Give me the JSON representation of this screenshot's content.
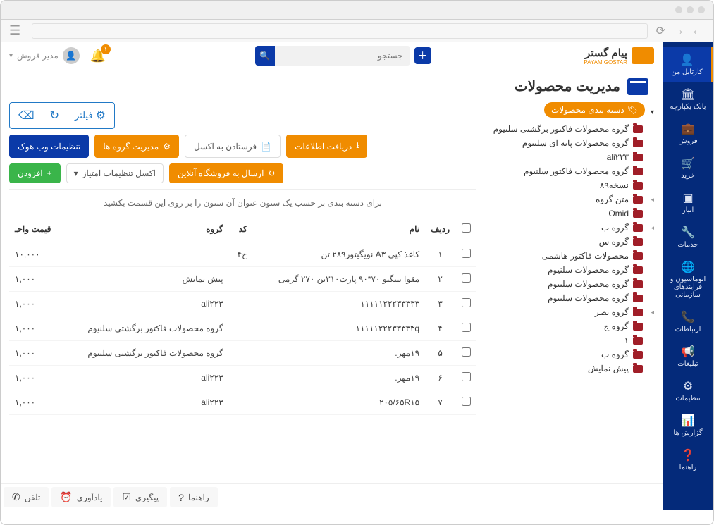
{
  "user": {
    "name": "مدیر فروش"
  },
  "notifications": {
    "count": "۱"
  },
  "search": {
    "placeholder": "جستجو"
  },
  "logo": {
    "text": "پیام گستر",
    "sub": "PAYAM GOSTAR"
  },
  "sidebar": {
    "items": [
      {
        "label": "کارتابل من"
      },
      {
        "label": "بانک یکپارچه"
      },
      {
        "label": "فروش"
      },
      {
        "label": "خرید"
      },
      {
        "label": "انبار"
      },
      {
        "label": "خدمات"
      },
      {
        "label": "اتوماسیون و فرآیندهای سازمانی"
      },
      {
        "label": "ارتباطات"
      },
      {
        "label": "تبلیغات"
      },
      {
        "label": "تنظیمات"
      },
      {
        "label": "گزارش ها"
      },
      {
        "label": "راهنما"
      }
    ]
  },
  "page": {
    "title": "مدیریت محصولات"
  },
  "tree": {
    "root": "دسته بندی محصولات",
    "items": [
      {
        "label": "گروه محصولات فاکتور برگشتی سلنیوم"
      },
      {
        "label": "گروه محصولات پایه ای سلنیوم"
      },
      {
        "label": "ali۲۲۳"
      },
      {
        "label": "گروه محصولات فاکتور سلنیوم"
      },
      {
        "label": "نسخه۸۹"
      },
      {
        "label": "متن گروه"
      },
      {
        "label": "Omid"
      },
      {
        "label": "گروه ب"
      },
      {
        "label": "گروه س"
      },
      {
        "label": "محصولات فاکتور هاشمی"
      },
      {
        "label": "گروه محصولات سلنیوم"
      },
      {
        "label": "گروه محصولات سلنیوم"
      },
      {
        "label": "گروه محصولات سلنیوم"
      },
      {
        "label": "گروه نصر"
      },
      {
        "label": "گروه ج"
      },
      {
        "label": "۱"
      },
      {
        "label": "گروه ب"
      },
      {
        "label": "پیش نمایش"
      }
    ]
  },
  "toolbar": {
    "filter": "فیلتر",
    "receive_info": "دریافت اطلاعات",
    "send_excel": "فرستادن به اکسل",
    "manage_groups": "مدیریت گروه ها",
    "webhook_settings": "تنظیمات وب هوک",
    "send_online_shop": "ارسال به فروشگاه آنلاین",
    "excel_settings": "اکسل تنظیمات امتیاز",
    "add": "افزودن"
  },
  "grid": {
    "hint": "برای دسته بندی بر حسب یک ستون عنوان آن ستون را بر روی این قسمت بکشید",
    "columns": [
      "ردیف",
      "نام",
      "کد",
      "گروه",
      "قیمت واحـ"
    ],
    "rows": [
      {
        "n": "۱",
        "name": "کاغذ کپی A۳ نویگیتور۲۸۹ تن",
        "code": "ج۴",
        "group": "",
        "price": "۱۰,۰۰۰"
      },
      {
        "n": "۲",
        "name": "مقوا نینگبو ۷۰*۹۰ پارت۳۱۰تن ۲۷۰ گرمی",
        "code": "",
        "group": "پیش نمایش",
        "price": "۱,۰۰۰"
      },
      {
        "n": "۳",
        "name": "۱۱۱۱۱۲۲۲۳۳۳۳۳",
        "code": "",
        "group": "ali۲۲۳",
        "price": "۱,۰۰۰"
      },
      {
        "n": "۴",
        "name": "۱۱۱۱۱۲۲۲۳۳۳۳۳q",
        "code": "",
        "group": "گروه محصولات فاکتور برگشتی سلنیوم",
        "price": "۱,۰۰۰"
      },
      {
        "n": "۵",
        "name": "۱۹مهر.",
        "code": "",
        "group": "گروه محصولات فاکتور برگشتی سلنیوم",
        "price": "۱,۰۰۰"
      },
      {
        "n": "۶",
        "name": "۱۹مهر.",
        "code": "",
        "group": "ali۲۲۳",
        "price": "۱,۰۰۰"
      },
      {
        "n": "۷",
        "name": "۲۰۵/۶۵R۱۵",
        "code": "",
        "group": "ali۲۲۳",
        "price": "۱,۰۰۰"
      }
    ]
  },
  "footer": {
    "phone": "تلفن",
    "reminder": "یادآوری",
    "followup": "پیگیری",
    "help": "راهنما"
  }
}
